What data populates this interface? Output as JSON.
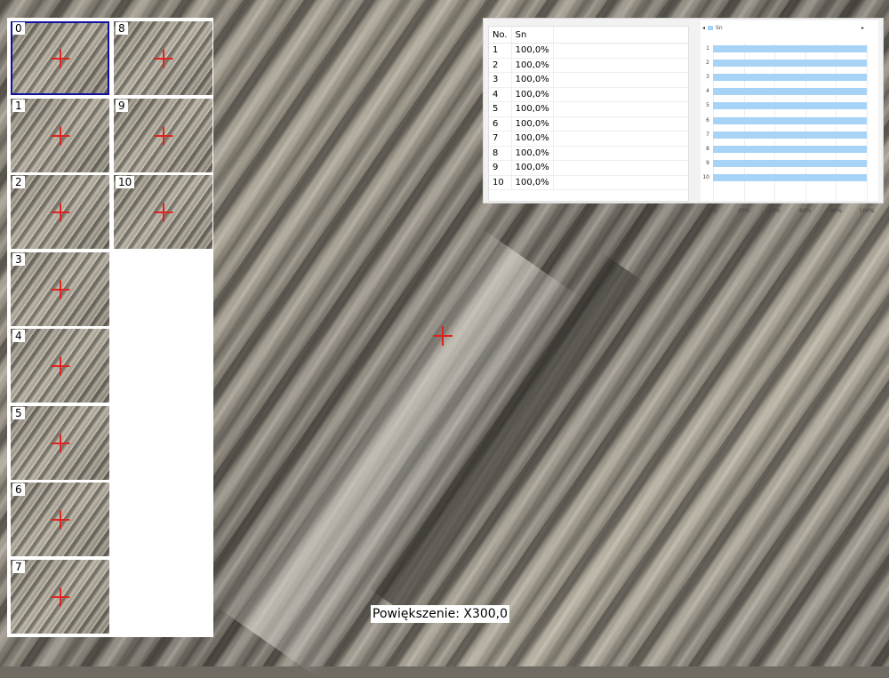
{
  "thumbnails": [
    {
      "label": "0",
      "selected": true
    },
    {
      "label": "1"
    },
    {
      "label": "2"
    },
    {
      "label": "3"
    },
    {
      "label": "4"
    },
    {
      "label": "5"
    },
    {
      "label": "6"
    },
    {
      "label": "7"
    },
    {
      "label": "8"
    },
    {
      "label": "9"
    },
    {
      "label": "10"
    }
  ],
  "results": {
    "columns": [
      "No.",
      "Sn"
    ],
    "rows": [
      [
        "1",
        "100,0%"
      ],
      [
        "2",
        "100,0%"
      ],
      [
        "3",
        "100,0%"
      ],
      [
        "4",
        "100,0%"
      ],
      [
        "5",
        "100,0%"
      ],
      [
        "6",
        "100,0%"
      ],
      [
        "7",
        "100,0%"
      ],
      [
        "8",
        "100,0%"
      ],
      [
        "9",
        "100,0%"
      ],
      [
        "10",
        "100,0%"
      ]
    ],
    "legend_prev_arrow": "◂",
    "legend_next_arrow": "▸"
  },
  "chart_data": {
    "type": "bar",
    "orientation": "horizontal",
    "categories": [
      "1",
      "2",
      "3",
      "4",
      "5",
      "6",
      "7",
      "8",
      "9",
      "10"
    ],
    "series": [
      {
        "name": "Sn",
        "values": [
          100,
          100,
          100,
          100,
          100,
          100,
          100,
          100,
          100,
          100
        ],
        "color": "#a7d3f7"
      }
    ],
    "xticks": [
      "0%",
      "20%",
      "40%",
      "60%",
      "80%",
      "100%"
    ],
    "xlim": [
      0,
      100
    ]
  },
  "zoom_label": "Powiększenie: X300,0",
  "colors": {
    "crosshair": "#e0201a",
    "selected_border": "#1010a0",
    "bar": "#a7d3f7"
  }
}
